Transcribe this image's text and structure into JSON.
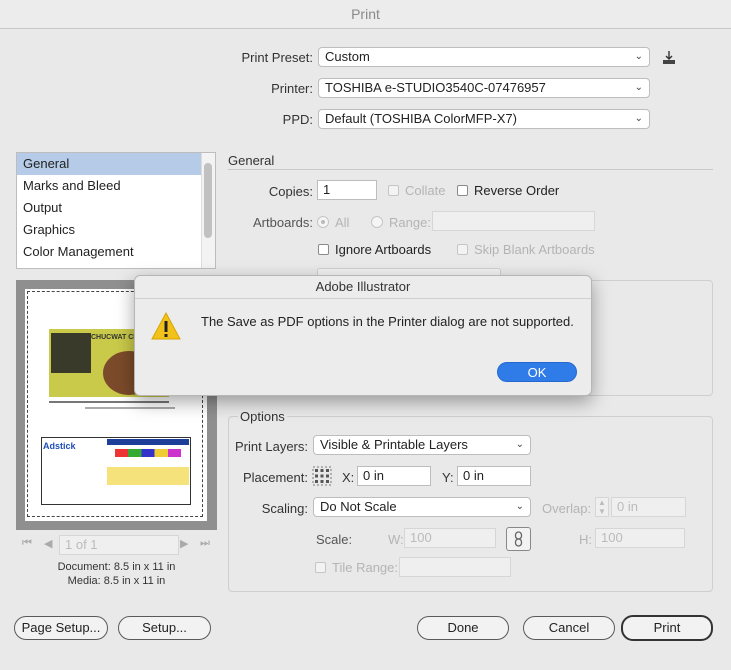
{
  "window": {
    "title": "Print"
  },
  "top": {
    "preset_label": "Print Preset:",
    "preset_value": "Custom",
    "printer_label": "Printer:",
    "printer_value": "TOSHIBA e-STUDIO3540C-07476957",
    "ppd_label": "PPD:",
    "ppd_value": "Default (TOSHIBA ColorMFP-X7)"
  },
  "sidebar": {
    "items": [
      {
        "label": "General",
        "selected": true
      },
      {
        "label": "Marks and Bleed"
      },
      {
        "label": "Output"
      },
      {
        "label": "Graphics"
      },
      {
        "label": "Color Management"
      }
    ]
  },
  "general": {
    "title": "General",
    "copies_label": "Copies:",
    "copies_value": "1",
    "collate_label": "Collate",
    "reverse_label": "Reverse Order",
    "artboards_label": "Artboards:",
    "all_label": "All",
    "range_label": "Range:",
    "ignore_label": "Ignore Artboards",
    "skip_label": "Skip Blank Artboards"
  },
  "options": {
    "title": "Options",
    "layers_label": "Print Layers:",
    "layers_value": "Visible & Printable Layers",
    "placement_label": "Placement:",
    "x_label": "X:",
    "x_value": "0 in",
    "y_label": "Y:",
    "y_value": "0 in",
    "scaling_label": "Scaling:",
    "scaling_value": "Do Not Scale",
    "overlap_label": "Overlap:",
    "overlap_value": "0 in",
    "scale_label": "Scale:",
    "w_label": "W:",
    "w_value": "100",
    "h_label": "H:",
    "h_value": "100",
    "tile_label": "Tile Range:"
  },
  "preview": {
    "page_indicator": "1 of 1",
    "document_line": "Document: 8.5 in x 11 in",
    "media_line": "Media: 8.5 in x 11 in",
    "thumb_title": "CHUCWAT CHILI",
    "thumb_brand": "Adstick"
  },
  "buttons": {
    "page_setup": "Page Setup...",
    "setup": "Setup...",
    "done": "Done",
    "cancel": "Cancel",
    "print": "Print"
  },
  "alert": {
    "title": "Adobe Illustrator",
    "message": "The Save as PDF options in the Printer dialog are not supported.",
    "ok": "OK",
    "icon": "warning-icon"
  },
  "colors": {
    "accent": "#2f7be8",
    "selection": "#b5cbe8",
    "warning": "#f2c21b"
  }
}
